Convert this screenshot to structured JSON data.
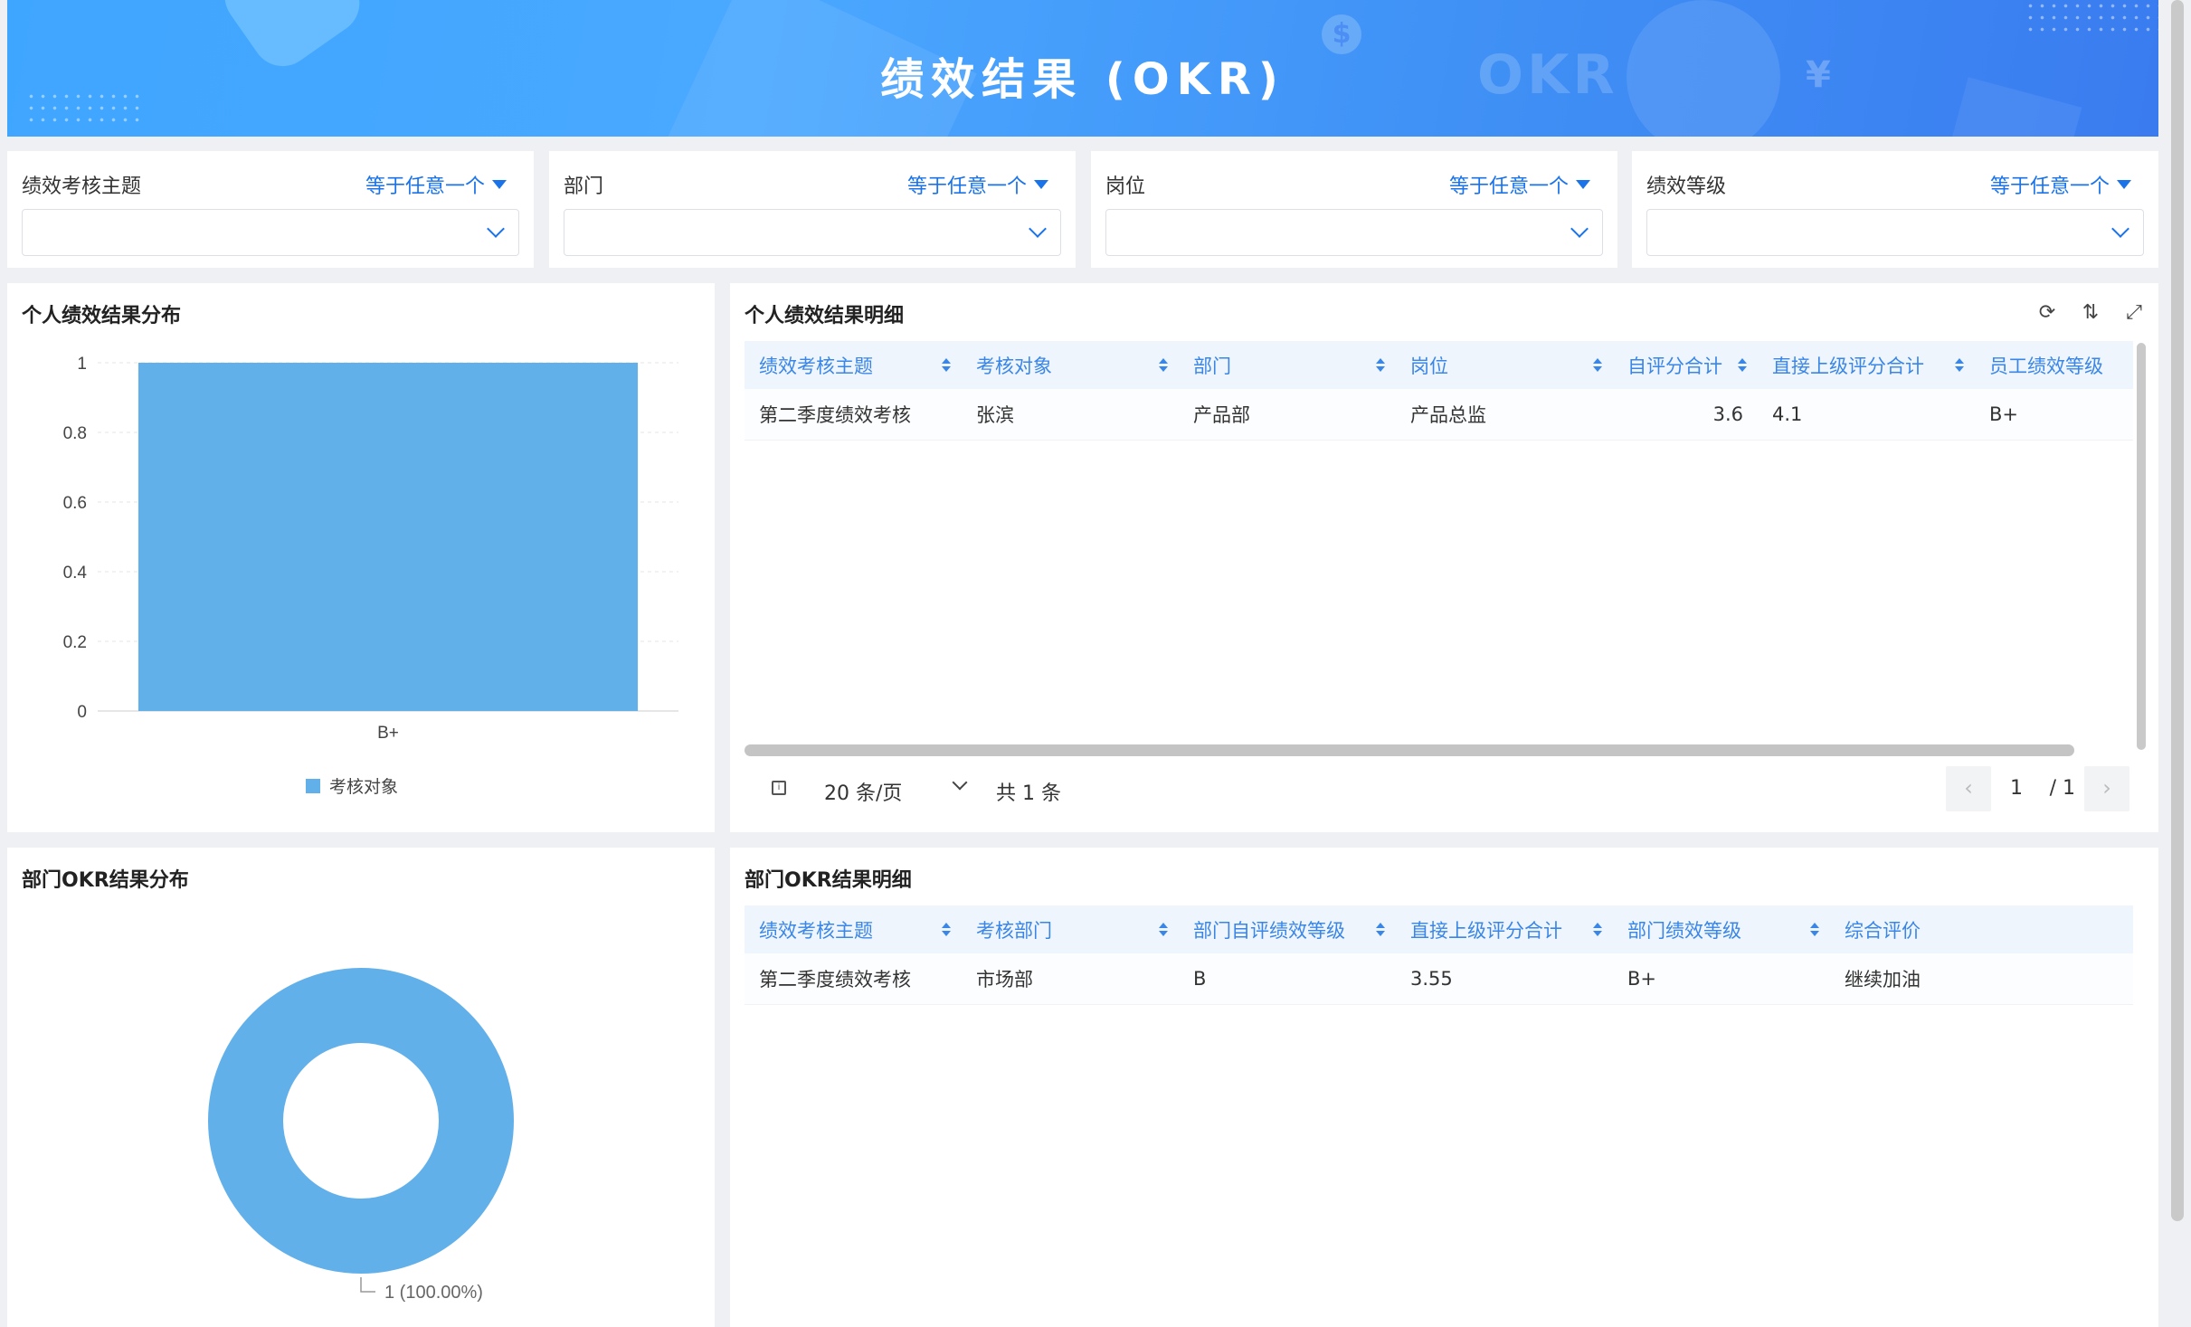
{
  "header": {
    "title": "绩效结果 (OKR)",
    "decor_text": "OKR"
  },
  "filters": [
    {
      "label": "绩效考核主题",
      "operator": "等于任意一个",
      "value": ""
    },
    {
      "label": "部门",
      "operator": "等于任意一个",
      "value": ""
    },
    {
      "label": "岗位",
      "operator": "等于任意一个",
      "value": ""
    },
    {
      "label": "绩效等级",
      "operator": "等于任意一个",
      "value": ""
    }
  ],
  "personal_chart": {
    "title": "个人绩效结果分布",
    "chart_data": {
      "type": "bar",
      "categories": [
        "B+"
      ],
      "series": [
        {
          "name": "考核对象",
          "values": [
            1
          ]
        }
      ],
      "yticks": [
        "0",
        "0.2",
        "0.4",
        "0.6",
        "0.8",
        "1"
      ],
      "ylim": [
        0,
        1
      ],
      "legend": "bottom",
      "color": "#62b0ea"
    }
  },
  "personal_table": {
    "title": "个人绩效结果明细",
    "columns": [
      "绩效考核主题",
      "考核对象",
      "部门",
      "岗位",
      "自评分合计",
      "直接上级评分合计",
      "员工绩效等级"
    ],
    "rows": [
      [
        "第二季度绩效考核",
        "张滨",
        "产品部",
        "产品总监",
        "3.6",
        "4.1",
        "B+"
      ]
    ],
    "pager": {
      "page_size": "20 条/页",
      "total": "共 1 条",
      "current": "1",
      "of": "/ 1"
    }
  },
  "dept_chart": {
    "title": "部门OKR结果分布",
    "chart_data": {
      "type": "pie",
      "donut": true,
      "slices": [
        {
          "label": "1 (100.00%)",
          "value": 1
        }
      ],
      "color": "#62b0ea"
    }
  },
  "dept_table": {
    "title": "部门OKR结果明细",
    "columns": [
      "绩效考核主题",
      "考核部门",
      "部门自评绩效等级",
      "直接上级评分合计",
      "部门绩效等级",
      "综合评价"
    ],
    "rows": [
      [
        "第二季度绩效考核",
        "市场部",
        "B",
        "3.55",
        "B+",
        "继续加油"
      ]
    ]
  }
}
